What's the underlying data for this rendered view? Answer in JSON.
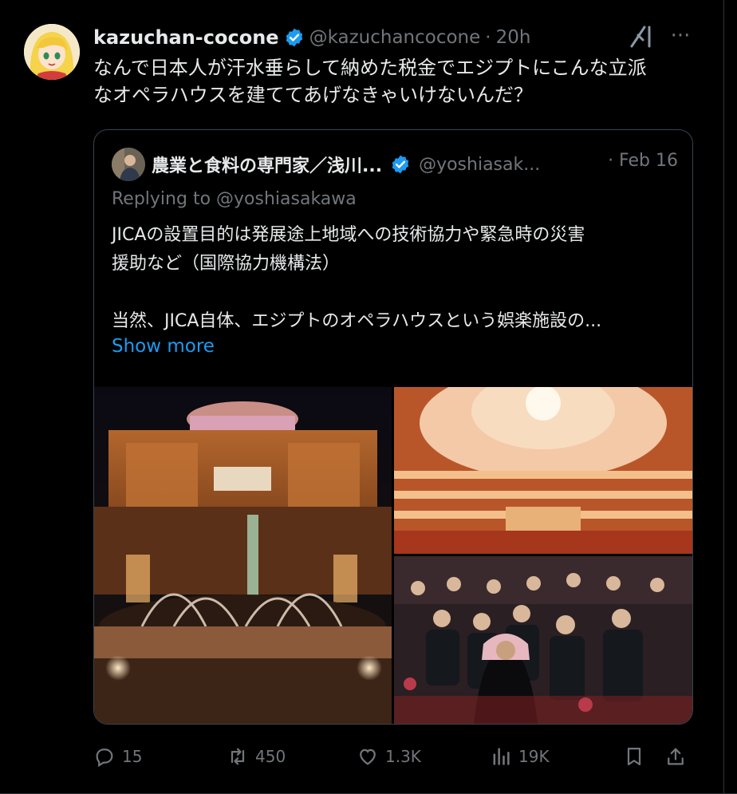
{
  "post": {
    "display_name": "kazuchan-cocone",
    "handle": "@kazuchancocone",
    "separator": "·",
    "time": "20h",
    "text_line1": "なんで日本人が汗水垂らして納めた税金でエジプトにこんな立派",
    "text_line2": "なオペラハウスを建ててあげなきゃいけないんだ？",
    "more_label": "···"
  },
  "quote": {
    "display_name": "農業と食料の専門家／浅川...",
    "handle": "@yoshiasak...",
    "date": "· Feb 16",
    "replying_to": "Replying to @yoshiasakawa",
    "text_line1": "JICAの設置目的は発展途上地域への技術協力や緊急時の災害",
    "text_line2": "援助など（国際協力機構法）",
    "text_line3": "当然、JICA自体、エジプトのオペラハウスという娯楽施設の...",
    "show_more": "Show more"
  },
  "actions": {
    "replies": "15",
    "reposts": "450",
    "likes": "1.3K",
    "views": "19K"
  },
  "colors": {
    "background": "#000000",
    "text": "#e7e9ea",
    "muted": "#71767b",
    "accent": "#1d9bf0",
    "border": "#38444d"
  },
  "icons": [
    "verified-badge-icon",
    "grok-icon",
    "more-icon",
    "reply-icon",
    "repost-icon",
    "like-icon",
    "views-icon",
    "bookmark-icon",
    "share-icon"
  ]
}
